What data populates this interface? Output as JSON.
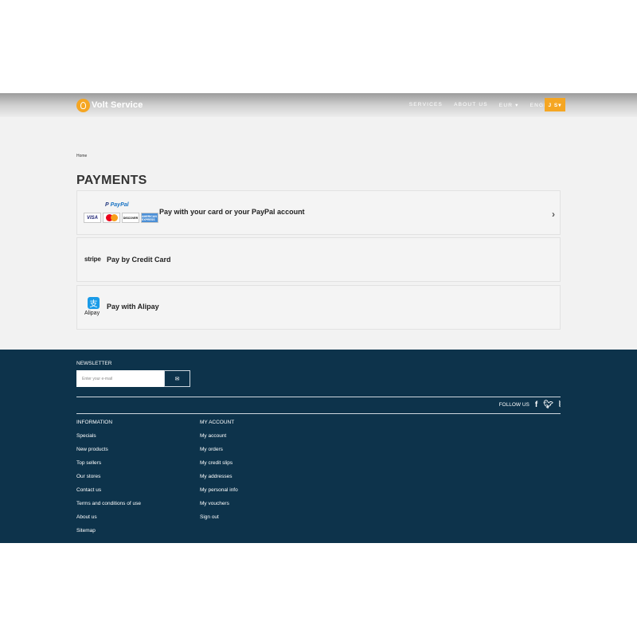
{
  "header": {
    "logo_text": "Volt Service",
    "nav": [
      "SERVICES",
      "ABOUT US",
      "EUR ▾",
      "ENGLISH ▾"
    ],
    "user_button": "J S▾",
    "accent_color": "#f5a623"
  },
  "breadcrumb": "Home",
  "page_title": "PAYMENTS",
  "payments": {
    "paypal": {
      "logo": "PayPal",
      "cards": [
        "VISA",
        "MasterCard",
        "DISCOVER",
        "AMERICAN EXPRESS"
      ],
      "label": "Pay with your card or your PayPal account"
    },
    "stripe": {
      "logo": "stripe",
      "label": "Pay by Credit Card"
    },
    "alipay": {
      "logo": "Alipay",
      "label": "Pay with Alipay"
    }
  },
  "footer": {
    "newsletter_title": "NEWSLETTER",
    "email_placeholder": "Enter your e-mail",
    "follow_us": "FOLLOW US",
    "social_icons": [
      "facebook-icon",
      "twitter-icon",
      "rss-icon"
    ],
    "information": {
      "title": "INFORMATION",
      "links": [
        "Specials",
        "New products",
        "Top sellers",
        "Our stores",
        "Contact us",
        "Terms and conditions of use",
        "About us",
        "Sitemap"
      ]
    },
    "my_account": {
      "title": "MY ACCOUNT",
      "links": [
        "My account",
        "My orders",
        "My credit slips",
        "My addresses",
        "My personal info",
        "My vouchers",
        "Sign out"
      ]
    },
    "background_color": "#0d334b"
  }
}
